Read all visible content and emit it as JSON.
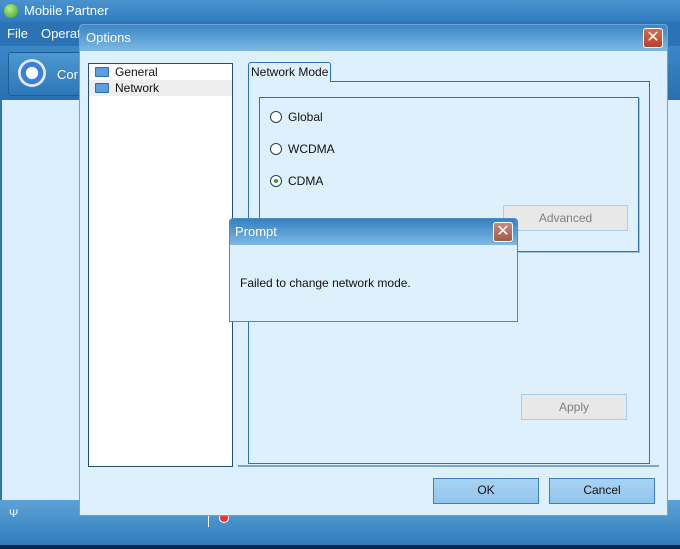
{
  "main_window": {
    "title": "Mobile Partner",
    "menu": [
      "File",
      "Operat"
    ],
    "toolbar_button": "Cor"
  },
  "options": {
    "title": "Options",
    "tree": [
      {
        "label": "General",
        "selected": false
      },
      {
        "label": "Network",
        "selected": true
      }
    ],
    "tab": "Network Mode",
    "radios": [
      {
        "label": "Global",
        "checked": false
      },
      {
        "label": "WCDMA",
        "checked": false
      },
      {
        "label": "CDMA",
        "checked": true
      }
    ],
    "advanced": "Advanced",
    "apply": "Apply",
    "ok": "OK",
    "cancel": "Cancel"
  },
  "prompt": {
    "title": "Prompt",
    "message": "Failed to change network mode."
  }
}
